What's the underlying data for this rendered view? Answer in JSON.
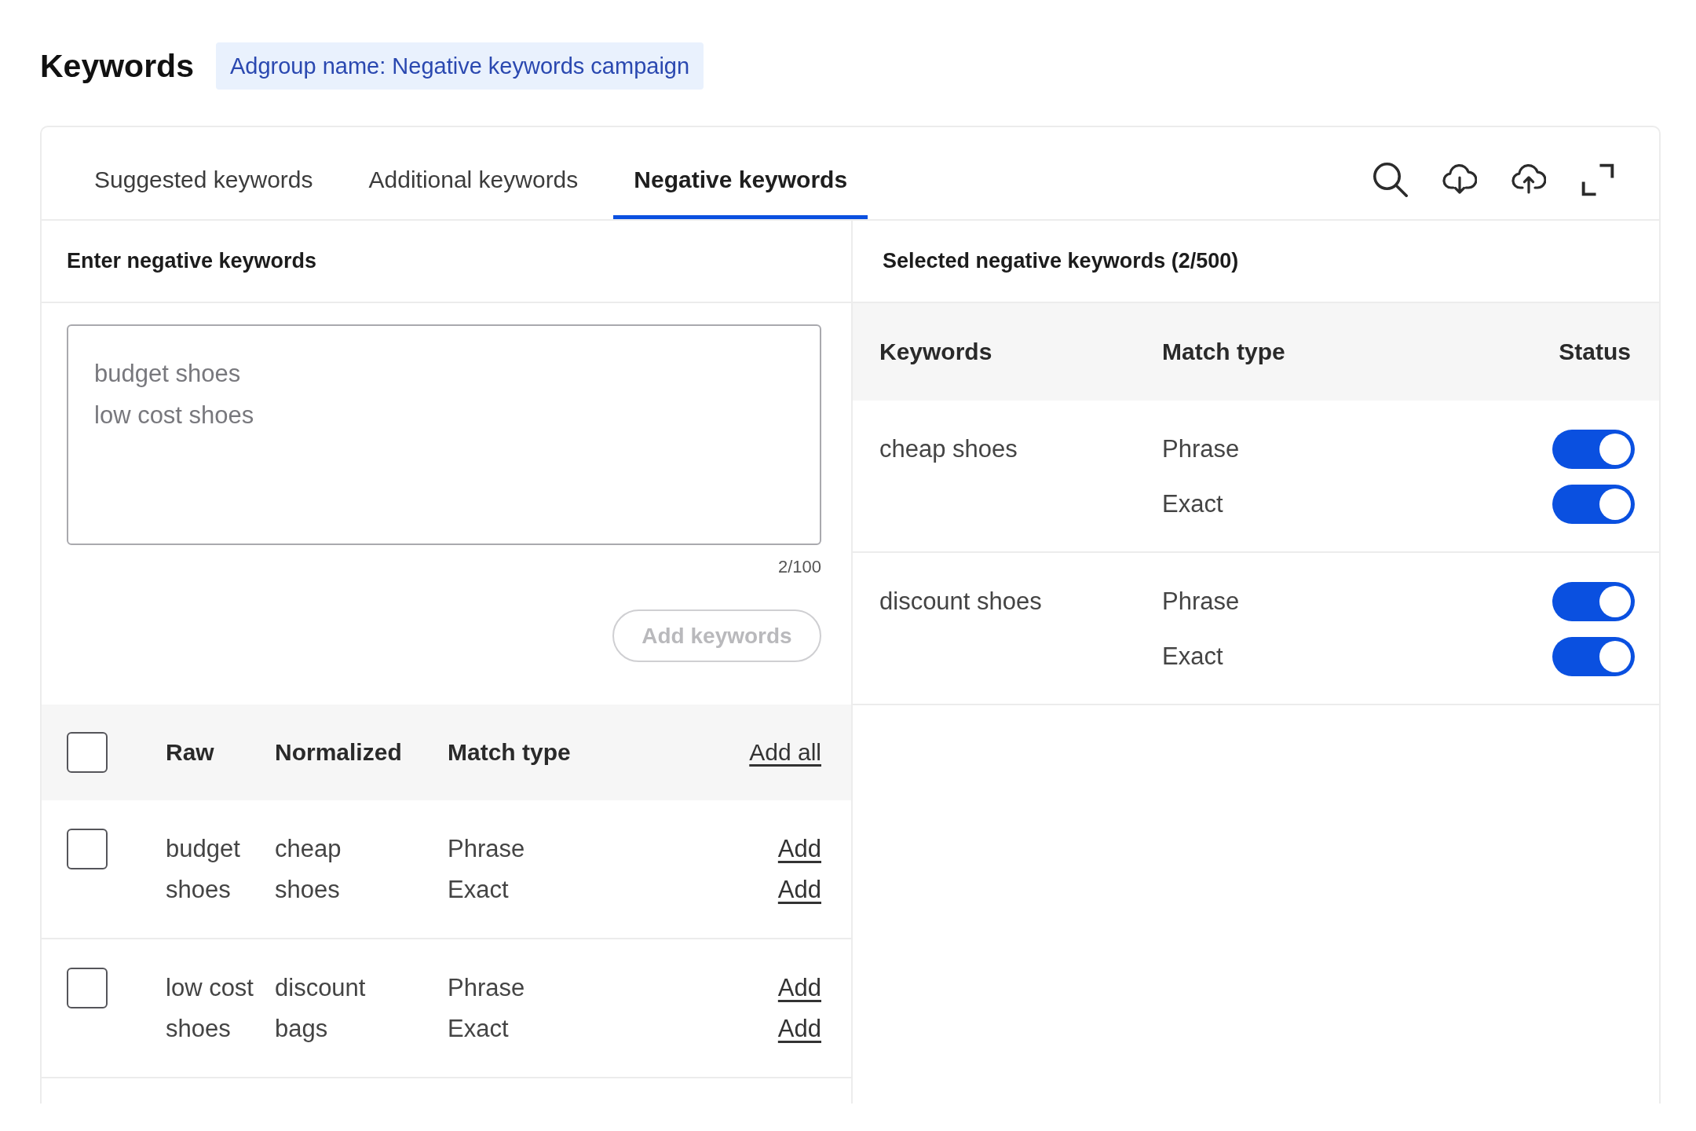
{
  "header": {
    "title": "Keywords",
    "adgroup_badge": "Adgroup name: Negative keywords campaign"
  },
  "tabs": [
    {
      "label": "Suggested keywords",
      "selected": false
    },
    {
      "label": "Additional keywords",
      "selected": false
    },
    {
      "label": "Negative keywords",
      "selected": true
    }
  ],
  "entry_panel": {
    "title": "Enter negative keywords",
    "keywords_input": {
      "value": "budget shoes\nlow cost shoes"
    },
    "counter": "2/100",
    "add_button": {
      "label": "Add keywords",
      "disabled": true
    },
    "table": {
      "select_all": {
        "checked": false
      },
      "columns": [
        "Raw",
        "Normalized",
        "Match type"
      ],
      "add_all": "Add all",
      "rows": [
        {
          "checked": false,
          "raw": "budget shoes",
          "normalized": "cheap shoes",
          "matches": [
            {
              "type": "Phrase",
              "action": "Add"
            },
            {
              "type": "Exact",
              "action": "Add"
            }
          ]
        },
        {
          "checked": false,
          "raw": "low cost shoes",
          "normalized": "discount bags",
          "matches": [
            {
              "type": "Phrase",
              "action": "Add"
            },
            {
              "type": "Exact",
              "action": "Add"
            }
          ]
        }
      ]
    }
  },
  "selected_panel": {
    "title": "Selected negative keywords (2/500)",
    "columns": [
      "Keywords",
      "Match type",
      "Status"
    ],
    "rows": [
      {
        "keyword": "cheap shoes",
        "matches": [
          {
            "type": "Phrase",
            "on": true
          },
          {
            "type": "Exact",
            "on": true
          }
        ]
      },
      {
        "keyword": "discount shoes",
        "matches": [
          {
            "type": "Phrase",
            "on": true
          },
          {
            "type": "Exact",
            "on": true
          }
        ]
      }
    ]
  }
}
